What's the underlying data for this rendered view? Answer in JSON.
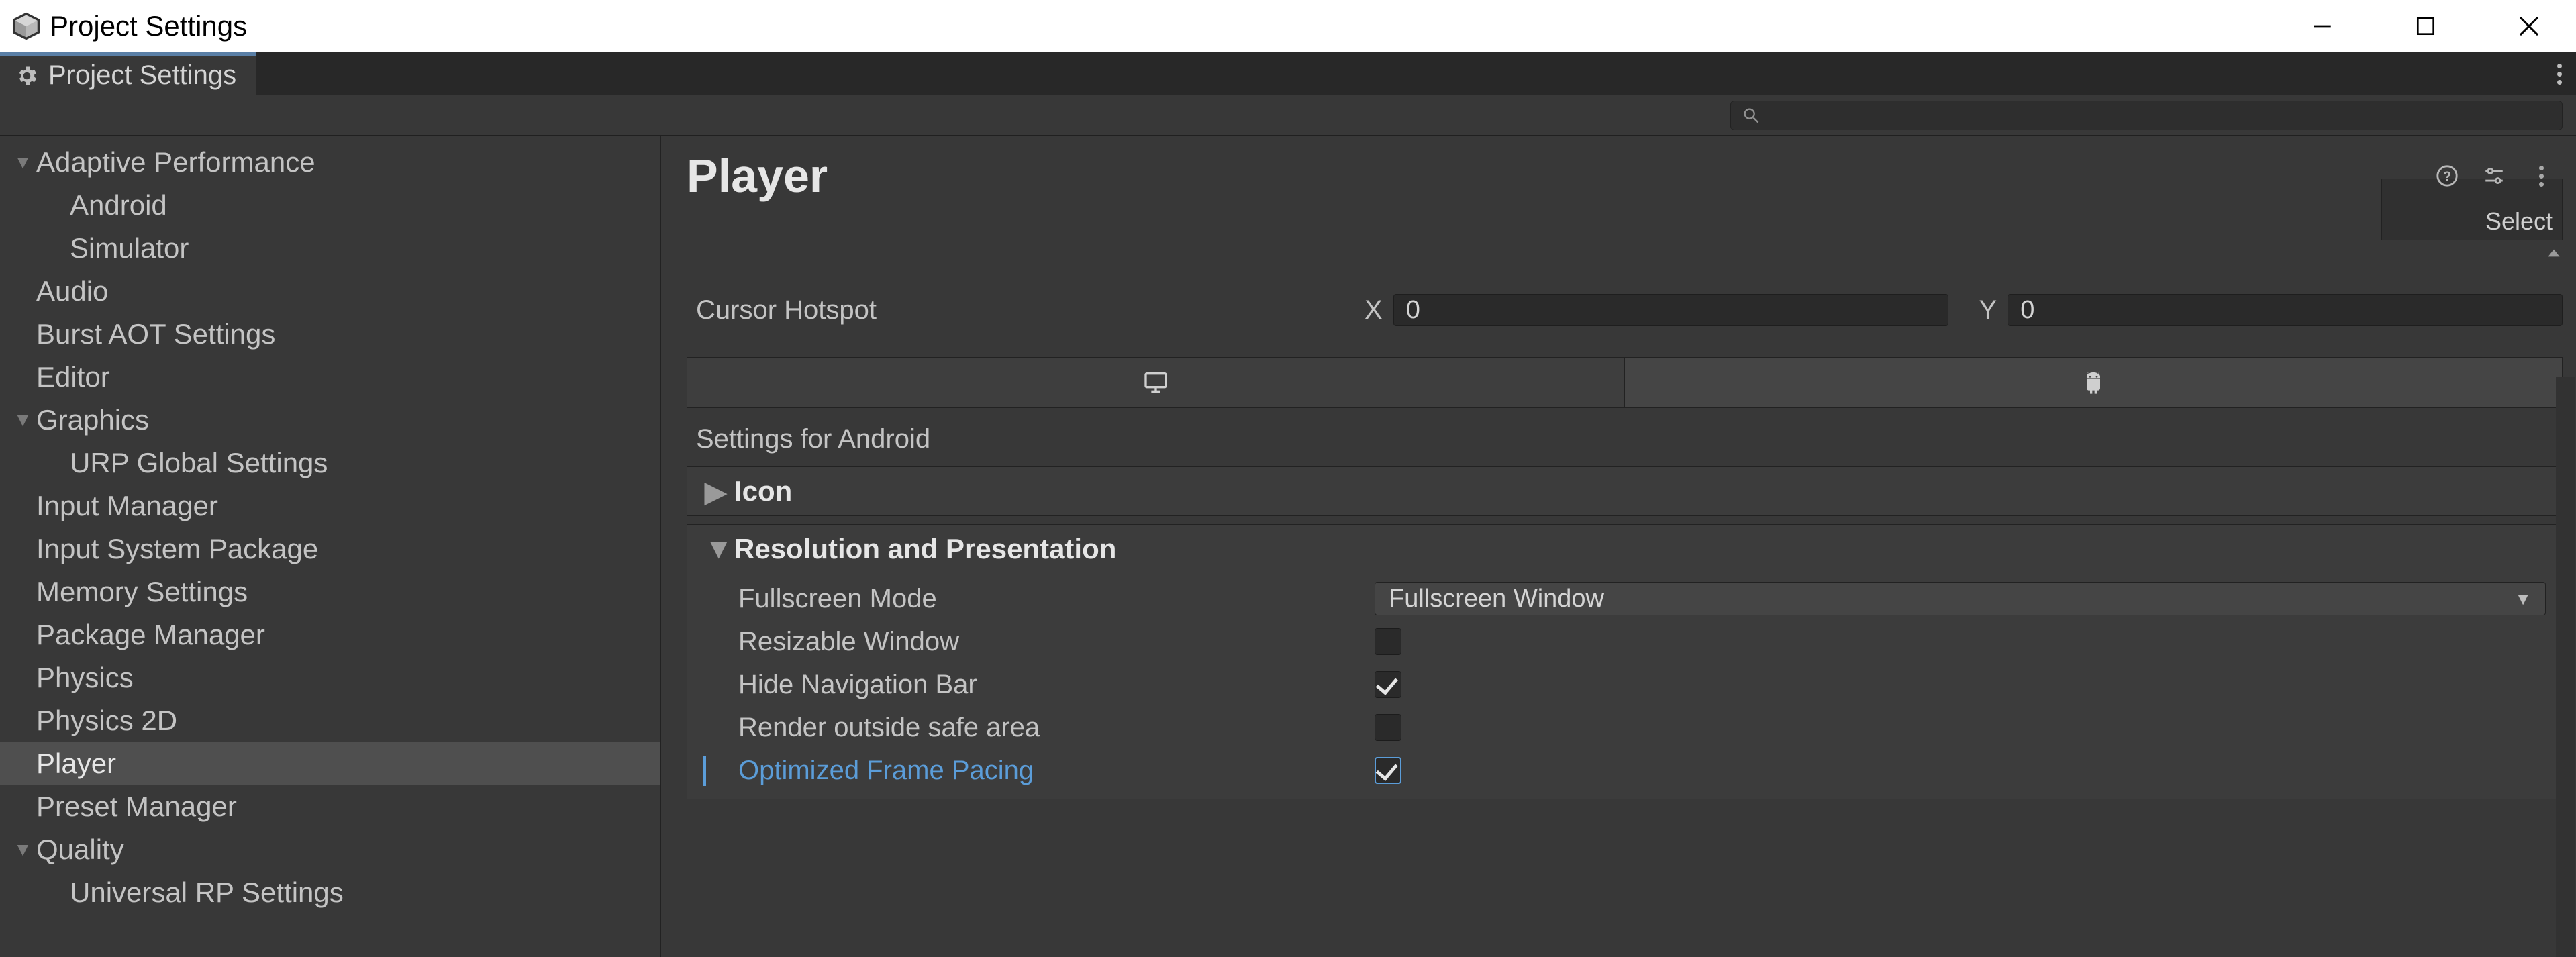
{
  "window": {
    "title": "Project Settings"
  },
  "tab": {
    "label": "Project Settings"
  },
  "search": {
    "placeholder": ""
  },
  "sidebar": {
    "items": [
      {
        "label": "Adaptive Performance",
        "fold": "open"
      },
      {
        "label": "Android",
        "child": true
      },
      {
        "label": "Simulator",
        "child": true
      },
      {
        "label": "Audio"
      },
      {
        "label": "Burst AOT Settings"
      },
      {
        "label": "Editor"
      },
      {
        "label": "Graphics",
        "fold": "open"
      },
      {
        "label": "URP Global Settings",
        "child": true
      },
      {
        "label": "Input Manager"
      },
      {
        "label": "Input System Package"
      },
      {
        "label": "Memory Settings"
      },
      {
        "label": "Package Manager"
      },
      {
        "label": "Physics"
      },
      {
        "label": "Physics 2D"
      },
      {
        "label": "Player",
        "selected": true
      },
      {
        "label": "Preset Manager"
      },
      {
        "label": "Quality",
        "fold": "open"
      },
      {
        "label": "Universal RP Settings",
        "child": true
      }
    ]
  },
  "page": {
    "title": "Player",
    "select_button": "Select",
    "cursor_hotspot": {
      "label": "Cursor Hotspot",
      "x_label": "X",
      "x_value": "0",
      "y_label": "Y",
      "y_value": "0"
    },
    "platform_section_title": "Settings for Android",
    "panels": {
      "icon": {
        "title": "Icon",
        "open": false
      },
      "resolution": {
        "title": "Resolution and Presentation",
        "open": true,
        "fullscreen_mode": {
          "label": "Fullscreen Mode",
          "value": "Fullscreen Window"
        },
        "resizable_window": {
          "label": "Resizable Window",
          "checked": false
        },
        "hide_nav_bar": {
          "label": "Hide Navigation Bar",
          "checked": true
        },
        "render_outside_safe": {
          "label": "Render outside safe area",
          "checked": false
        },
        "optimized_frame_pacing": {
          "label": "Optimized Frame Pacing",
          "checked": true,
          "highlighted": true
        }
      }
    }
  }
}
